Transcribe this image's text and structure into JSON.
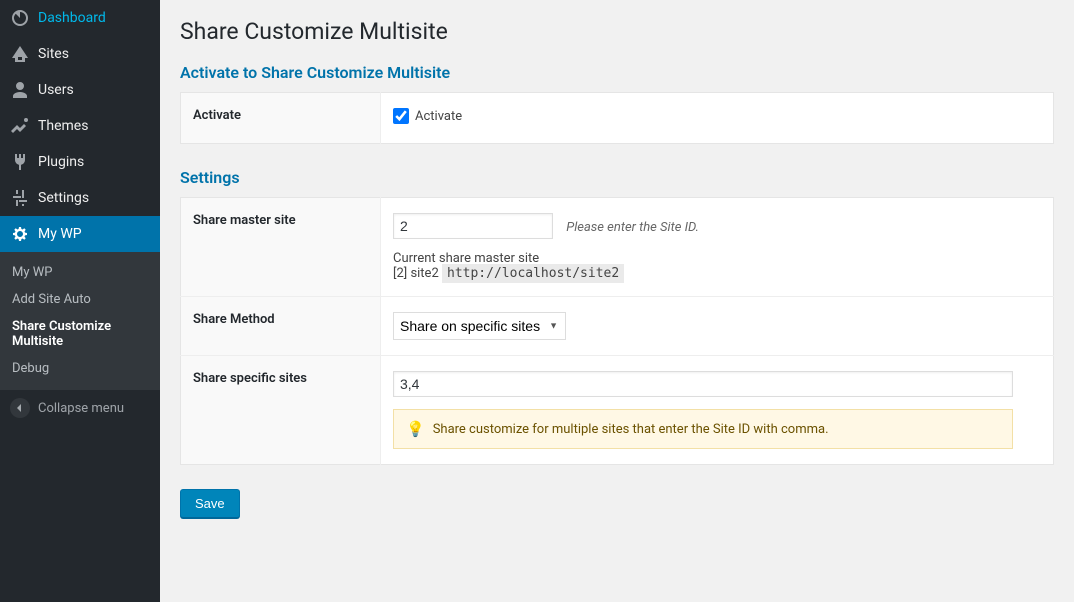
{
  "sidebar": {
    "items": [
      {
        "label": "Dashboard",
        "icon": "dashboard-icon"
      },
      {
        "label": "Sites",
        "icon": "sites-icon"
      },
      {
        "label": "Users",
        "icon": "users-icon"
      },
      {
        "label": "Themes",
        "icon": "themes-icon"
      },
      {
        "label": "Plugins",
        "icon": "plugins-icon"
      },
      {
        "label": "Settings",
        "icon": "settings-icon"
      },
      {
        "label": "My WP",
        "icon": "gear-icon"
      }
    ],
    "submenu": [
      {
        "label": "My WP"
      },
      {
        "label": "Add Site Auto"
      },
      {
        "label": "Share Customize Multisite"
      },
      {
        "label": "Debug"
      }
    ],
    "collapse": "Collapse menu"
  },
  "page": {
    "title": "Share Customize Multisite",
    "section_activate_title": "Activate to Share Customize Multisite",
    "section_settings_title": "Settings",
    "activate_row_label": "Activate",
    "activate_checkbox_label": "Activate",
    "activate_checked": true,
    "share_master_label": "Share master site",
    "share_master_value": "2",
    "share_master_hint": "Please enter the Site ID.",
    "current_master_label": "Current share master site",
    "current_master_site_id": "2",
    "current_master_site_name": "site2",
    "current_master_url": "http://localhost/site2",
    "share_method_label": "Share Method",
    "share_method_value": "Share on specific sites",
    "share_specific_label": "Share specific sites",
    "share_specific_value": "3,4",
    "share_specific_notice": "Share customize for multiple sites that enter the Site ID with comma.",
    "save_button": "Save"
  },
  "colors": {
    "primary": "#0073aa",
    "sidebar_bg": "#23282d"
  }
}
